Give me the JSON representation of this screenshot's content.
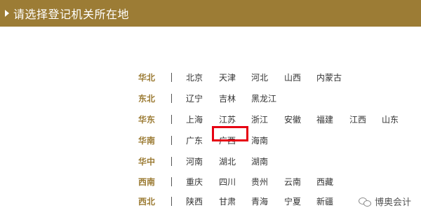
{
  "header": {
    "title": "请选择登记机关所在地"
  },
  "regions": [
    {
      "name": "华北",
      "provinces": [
        "北京",
        "天津",
        "河北",
        "山西",
        "内蒙古"
      ]
    },
    {
      "name": "东北",
      "provinces": [
        "辽宁",
        "吉林",
        "黑龙江"
      ]
    },
    {
      "name": "华东",
      "provinces": [
        "上海",
        "江苏",
        "浙江",
        "安徽",
        "福建",
        "江西",
        "山东"
      ]
    },
    {
      "name": "华南",
      "provinces": [
        "广东",
        "广西",
        "海南"
      ]
    },
    {
      "name": "华中",
      "provinces": [
        "河南",
        "湖北",
        "湖南"
      ]
    },
    {
      "name": "西南",
      "provinces": [
        "重庆",
        "四川",
        "贵州",
        "云南",
        "西藏"
      ]
    },
    {
      "name": "西北",
      "provinces": [
        "陕西",
        "甘肃",
        "青海",
        "宁夏",
        "新疆"
      ]
    }
  ],
  "selected": "广西",
  "colors": {
    "header_bg": "#9c7c35",
    "region_label": "#9c7c35",
    "highlight": "#e60012"
  },
  "watermark": {
    "text": "博奥会计"
  }
}
